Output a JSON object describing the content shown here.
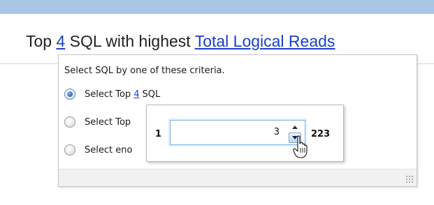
{
  "heading": {
    "prefix": "Top",
    "count_link": "4",
    "middle": "SQL with highest",
    "metric_link": "Total Logical Reads"
  },
  "popup": {
    "instruction": "Select SQL by one of these criteria.",
    "options": [
      {
        "before": "Select Top",
        "link": "4",
        "after": "SQL",
        "checked": true
      },
      {
        "before": "Select Top",
        "checked": false
      },
      {
        "before": "Select eno",
        "checked": false
      }
    ]
  },
  "spinner": {
    "min": "1",
    "value": "3",
    "max": "223"
  },
  "colors": {
    "topbar": "#a9c6e6",
    "link": "#1a3fc9",
    "focus_border": "#7eb4ea"
  }
}
